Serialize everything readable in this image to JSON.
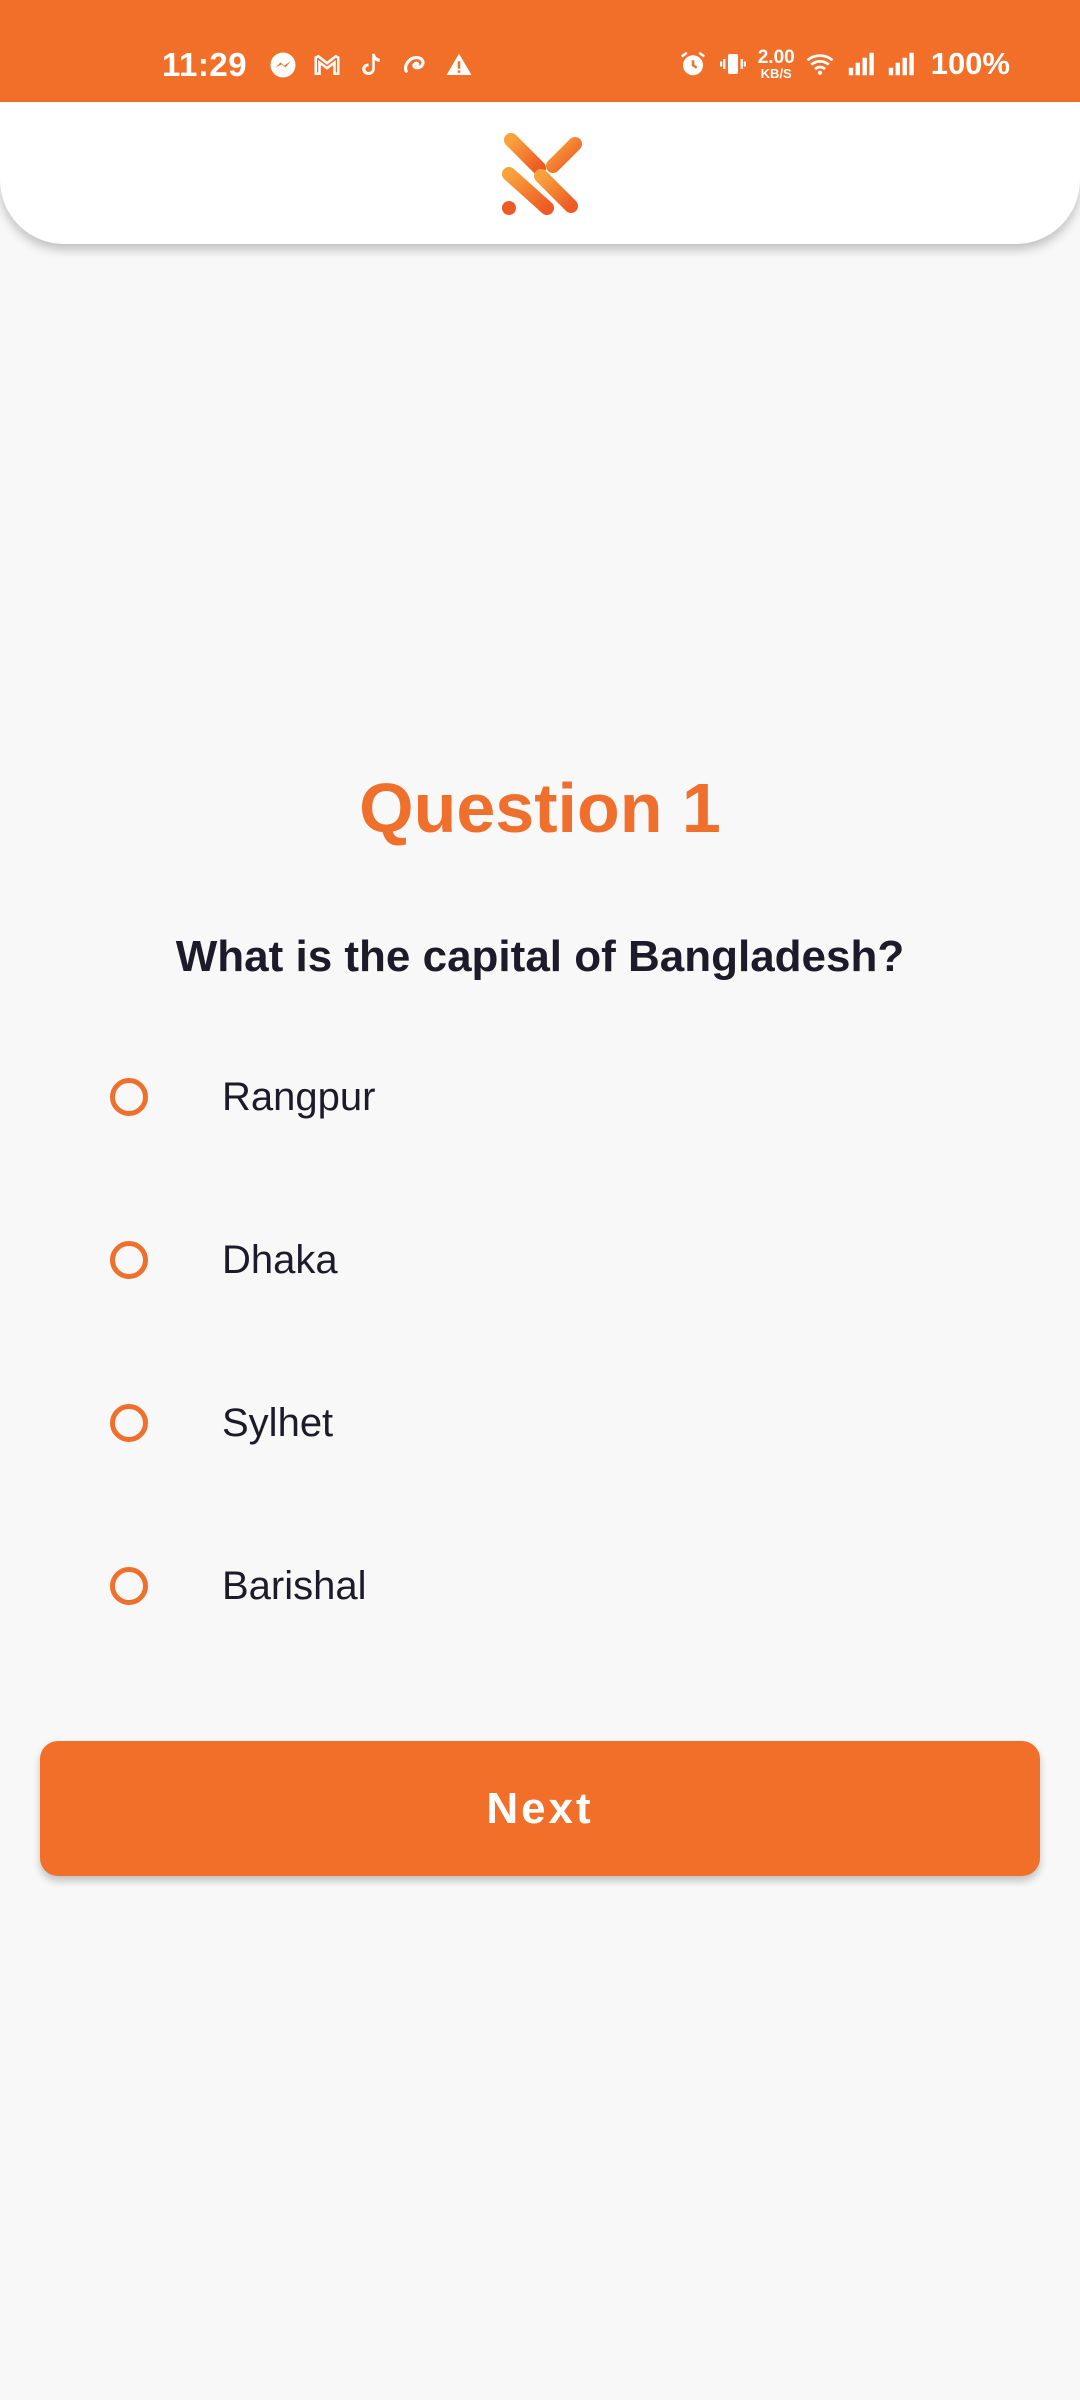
{
  "status_bar": {
    "time": "11:29",
    "left_icons": [
      "messenger-icon",
      "gmail-icon",
      "tiktok-icon",
      "airtel-icon",
      "warning-icon"
    ],
    "right_icons": [
      "alarm-icon",
      "vibrate-icon",
      "wifi-icon",
      "signal-icon",
      "signal-icon"
    ],
    "net_speed_value": "2.00",
    "net_speed_unit": "KB/S",
    "battery": "100%",
    "background_color": "#f26f29"
  },
  "header": {
    "logo_icon": "app-logo-icon"
  },
  "question": {
    "title": "Question 1",
    "text": "What is the capital of Bangladesh?",
    "options": [
      {
        "label": "Rangpur",
        "selected": false
      },
      {
        "label": "Dhaka",
        "selected": false
      },
      {
        "label": "Sylhet",
        "selected": false
      },
      {
        "label": "Barishal",
        "selected": false
      }
    ]
  },
  "actions": {
    "next_label": "Next"
  },
  "colors": {
    "accent": "#f26f29",
    "title": "#ef6f2c",
    "text": "#1d1b2a",
    "background": "#f8f8f8"
  }
}
